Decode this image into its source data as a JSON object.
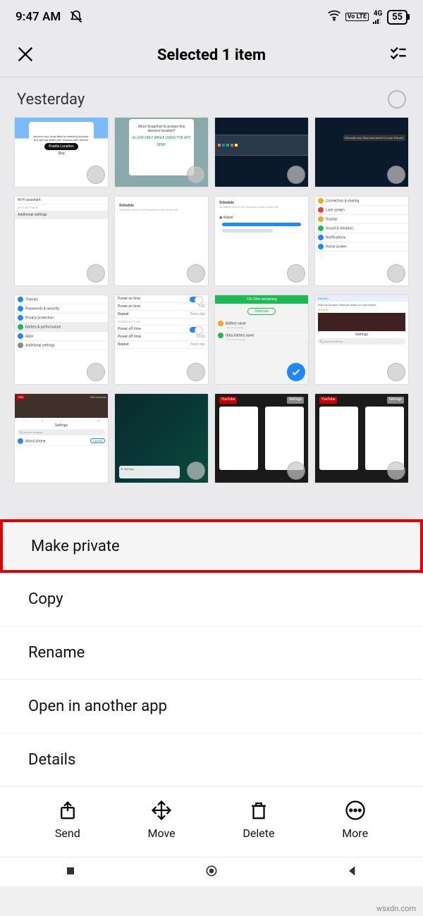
{
  "status": {
    "time": "9:47 AM",
    "network_badge": "Vo LTE",
    "network_gen": "4G",
    "battery": "55"
  },
  "header": {
    "title": "Selected 1 item"
  },
  "section": {
    "label": "Yesterday"
  },
  "thumbs": {
    "r1c1": {
      "modal_btn": "Enable Location",
      "skip": "Skip"
    },
    "r1c2": {
      "txt": "Allow Snapchat to access this device's location?",
      "allow": "ALLOW ONLY WHILE USING THE APP",
      "deny": "DENY"
    },
    "r2c1": {
      "top": "Wi-Fi assistant",
      "sub": "WI-FI SETTINGS",
      "item": "Additional settings"
    },
    "r2c2": {
      "h": "Schedule",
      "sub": "Schedule time to turn Reading mode on and off"
    },
    "r2c3": {
      "h": "Schedule",
      "sub": "Schedule time to turn Reading mode on and off",
      "adj": "Adjust"
    },
    "r2c4": {
      "a": "Connection & sharing",
      "b": "Lock screen",
      "c": "Display",
      "d": "Sound & vibration",
      "e": "Notifications",
      "f": "Home screen"
    },
    "r3c1": {
      "a": "Themes",
      "b": "Passwords & security",
      "c": "Privacy protection",
      "d": "Battery & performance",
      "e": "Apps",
      "f": "Additional settings"
    },
    "r3c2": {
      "a": "Power on time",
      "b": "Power on time",
      "c": "Repeat",
      "d": "POWER OFF TIME",
      "e": "Power off time",
      "f": "Power off time",
      "g": "Repeat",
      "v": "Every day"
    },
    "r3c3": {
      "top": "Optimise",
      "a": "Battery saver",
      "b": "Ultra battery saver"
    },
    "r3c4": {
      "install": "INSTALL",
      "txt": "Files by Google: Clean up space on your phone",
      "s": "Settings",
      "q": "Search settings"
    },
    "r4c1": {
      "title": "Yeh Dooriyan",
      "badge": "18M",
      "s": "Settings",
      "q": "Search settings",
      "about": "About phone",
      "upd": "Update"
    },
    "r4c3": {
      "yt": "YouTube",
      "set": "Settings"
    },
    "r4c4": {
      "yt": "YouTube",
      "set": "Settings"
    }
  },
  "sheet": {
    "items": [
      "Make private",
      "Copy",
      "Rename",
      "Open in another app",
      "Details"
    ],
    "actions": [
      "Send",
      "Move",
      "Delete",
      "More"
    ]
  },
  "watermark": "wsxdn.com"
}
